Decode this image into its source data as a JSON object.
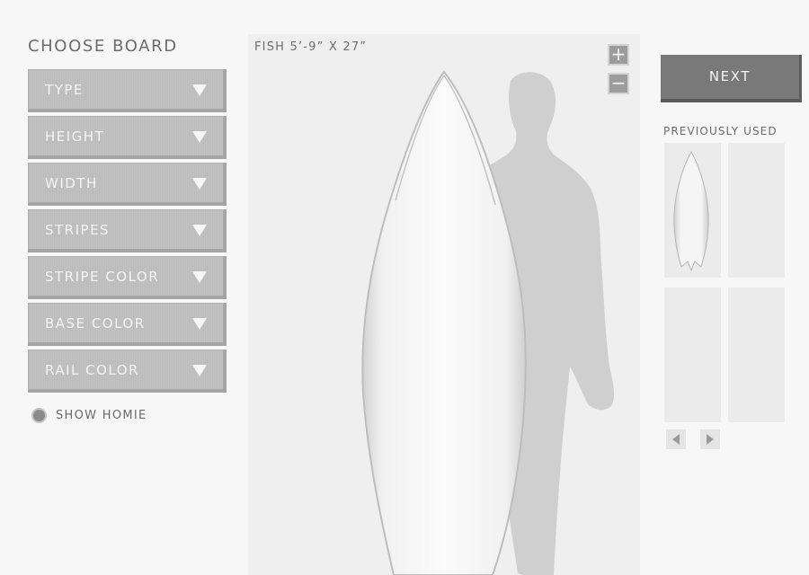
{
  "left_panel": {
    "title": "CHOOSE BOARD",
    "options": [
      {
        "label": "TYPE"
      },
      {
        "label": "HEIGHT"
      },
      {
        "label": "WIDTH"
      },
      {
        "label": "STRIPES"
      },
      {
        "label": "STRIPE COLOR"
      },
      {
        "label": "BASE COLOR"
      },
      {
        "label": "RAIL COLOR"
      }
    ],
    "caret_icon": "triangle-down-icon",
    "show_homie": {
      "label": "SHOW HOMIE",
      "checked": true
    }
  },
  "preview": {
    "caption": "FISH 5’-9” X 27”",
    "zoom_in_label": "+",
    "zoom_out_label": "−"
  },
  "right_panel": {
    "next_label": "NEXT",
    "history_title": "PREVIOUSLY USED",
    "slots": [
      {
        "has_board": true
      },
      {
        "has_board": false
      },
      {
        "has_board": false
      },
      {
        "has_board": false
      }
    ],
    "prev_icon": "triangle-left-icon",
    "next_icon": "triangle-right-icon"
  },
  "colors": {
    "background": "#f7f7f7",
    "option_fill": "#bfbfbf",
    "next_button": "#797979",
    "silhouette": "#cfcfcf",
    "board": "#fafafa"
  }
}
